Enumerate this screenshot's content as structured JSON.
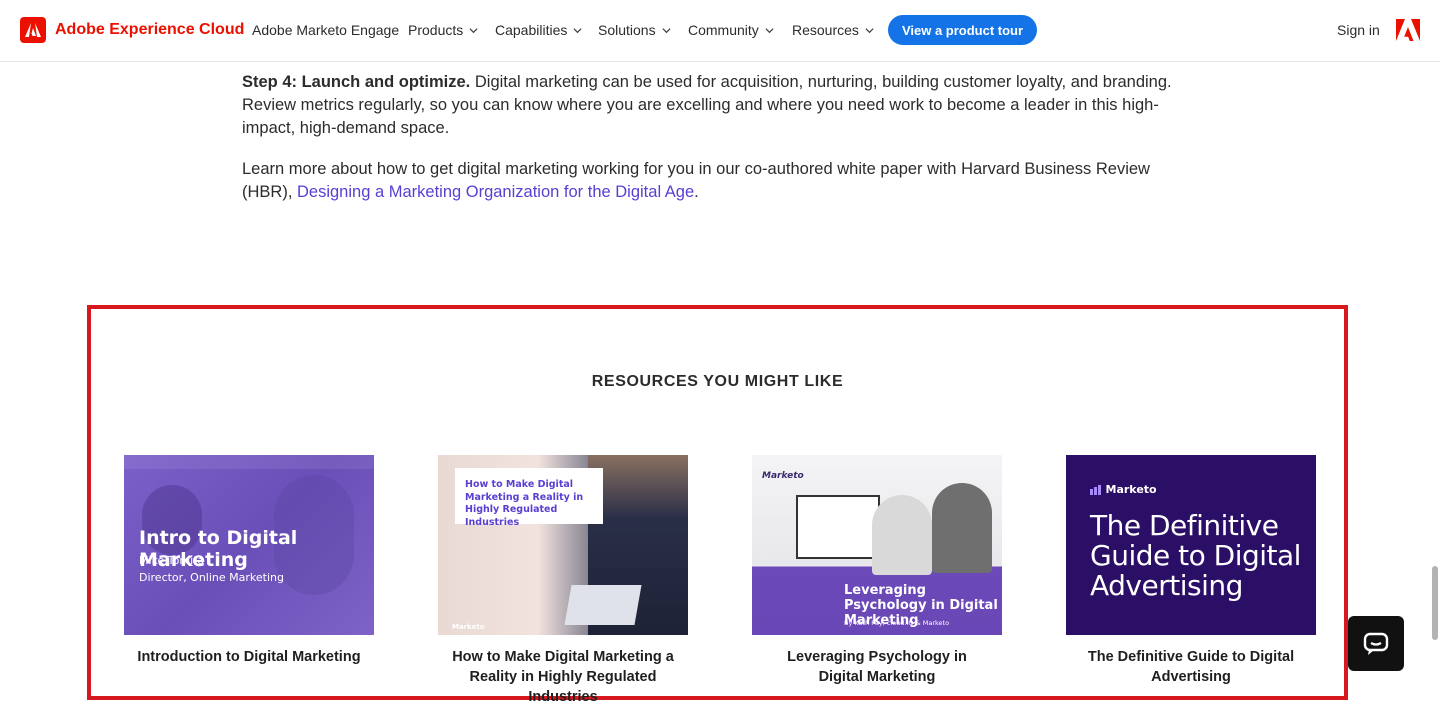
{
  "header": {
    "brand": "Adobe Experience Cloud",
    "nav": [
      {
        "label": "Adobe Marketo Engage",
        "dropdown": false
      },
      {
        "label": "Products",
        "dropdown": true
      },
      {
        "label": "Capabilities",
        "dropdown": true
      },
      {
        "label": "Solutions",
        "dropdown": true
      },
      {
        "label": "Community",
        "dropdown": true
      },
      {
        "label": "Resources",
        "dropdown": true
      }
    ],
    "cta": "View a product tour",
    "signin": "Sign in",
    "accent": "#eb1000",
    "cta_color": "#1473e6"
  },
  "article": {
    "step4_label": "Step 4: Launch and optimize.",
    "step4_text": " Digital marketing can be used for acquisition, nurturing, building customer loyalty, and branding. Review metrics regularly, so you can know where you are excelling and where you need work to become a leader in this high-impact, high-demand space.",
    "learn_text": "Learn more about how to get digital marketing working for you in our co-authored white paper with Harvard Business Review (HBR), ",
    "learn_link": "Designing a Marketing Organization for the Digital Age",
    "learn_end": "."
  },
  "resources": {
    "heading": "RESOURCES YOU MIGHT LIKE",
    "cards": [
      {
        "title": "Introduction to Digital Marketing",
        "thumb_heading": "Intro to Digital Marketing",
        "thumb_line1": "Mike Tomita",
        "thumb_line2": "Director, Online Marketing"
      },
      {
        "title": "How to Make Digital Marketing a Reality in Highly Regulated Industries",
        "thumb_heading": "How to Make Digital Marketing a Reality in Highly Regulated Industries",
        "thumb_logo": "Marketo"
      },
      {
        "title": "Leveraging Psychology in Digital Marketing",
        "thumb_logo": "Marketo",
        "thumb_heading": "Leveraging Psychology in Digital Marketing",
        "thumb_byline": "By Kath Pay, cloud.IQ & Marketo"
      },
      {
        "title": "The Definitive Guide to Digital Advertising",
        "thumb_logo": "Marketo",
        "thumb_heading": "The Definitive Guide to Digital Advertising"
      }
    ],
    "highlight_color": "#d7181f"
  }
}
